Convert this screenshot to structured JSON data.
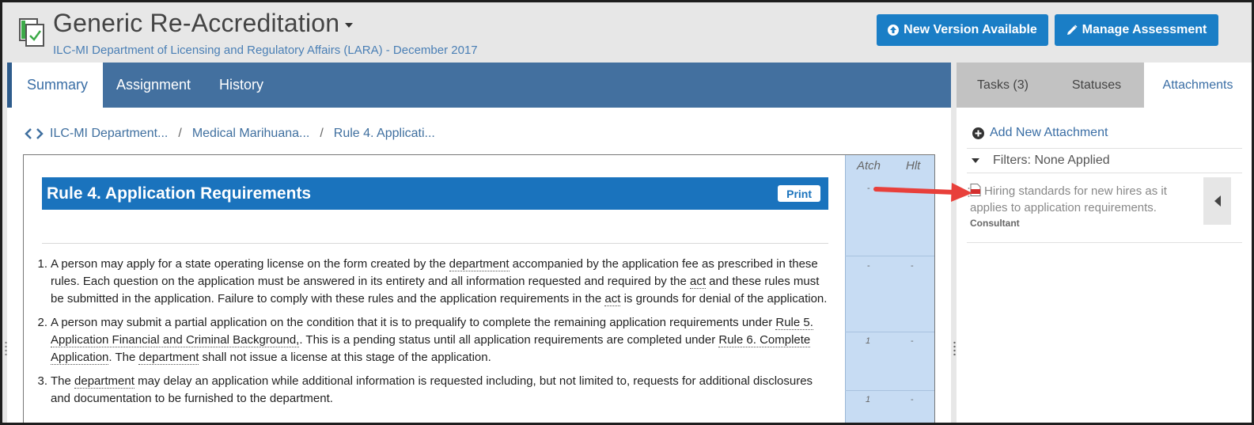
{
  "header": {
    "title": "Generic Re-Accreditation",
    "subtitle": "ILC-MI Department of Licensing and Regulatory Affairs (LARA) - December 2017",
    "new_version_label": "New Version Available",
    "manage_label": "Manage Assessment"
  },
  "tabs": [
    {
      "label": "Summary",
      "active": true
    },
    {
      "label": "Assignment",
      "active": false
    },
    {
      "label": "History",
      "active": false
    }
  ],
  "breadcrumb": [
    "ILC-MI Department...",
    "Medical Marihuana...",
    "Rule 4. Applicati..."
  ],
  "breadcrumb_sep": "/",
  "document": {
    "col_atch": "Atch",
    "col_hlt": "Hlt",
    "rule_title": "Rule 4. Application Requirements",
    "print_label": "Print",
    "title_row": {
      "atch": "-"
    },
    "rows": [
      {
        "atch": "-",
        "hlt": "-"
      },
      {
        "atch": "1",
        "hlt": "-"
      },
      {
        "atch": "1",
        "hlt": "-"
      }
    ],
    "items": [
      {
        "num": "1.",
        "t1": "A person may apply for a state operating license on the form created by the ",
        "l1": "department",
        "t2": " accompanied by the application fee as prescribed in these rules. Each question on the application must be answered in its entirety and all information requested and required by the ",
        "l2": "act",
        "t3": " and these rules must be submitted in the application. Failure to comply with these rules and the application requirements in the ",
        "l3": "act",
        "t4": " is grounds for denial of the application."
      },
      {
        "num": "2.",
        "t1": "A person may submit a partial application on the condition that it is to prequalify to complete the remaining application requirements under ",
        "l1": "Rule 5. Application Financial and Criminal Background,",
        "t2": ". This is a pending status until all application requirements are completed under ",
        "l2": "Rule 6. Complete Application",
        "t3": ". The ",
        "l3": "department",
        "t4": " shall not issue a license at this stage of the application."
      },
      {
        "num": "3.",
        "t1": "The ",
        "l1": "department",
        "t2": " may delay an application while additional information is requested including, but not limited to, requests for additional disclosures and documentation to be furnished to the department."
      }
    ]
  },
  "right_panel": {
    "tabs": [
      {
        "label": "Tasks (3)"
      },
      {
        "label": "Statuses"
      },
      {
        "label": "Attachments",
        "active": true
      }
    ],
    "add_attachment": "Add New Attachment",
    "filters": "Filters: None Applied",
    "attachment": {
      "title": "Hiring standards for new hires as it applies to application requirements.",
      "role": "Consultant"
    }
  },
  "colors": {
    "brand_blue": "#1a7ec6",
    "tab_bar": "#43709f",
    "rule_bar": "#1a73bd",
    "column_bg": "#c7dcf3",
    "annotation_arrow": "#e8403b"
  }
}
